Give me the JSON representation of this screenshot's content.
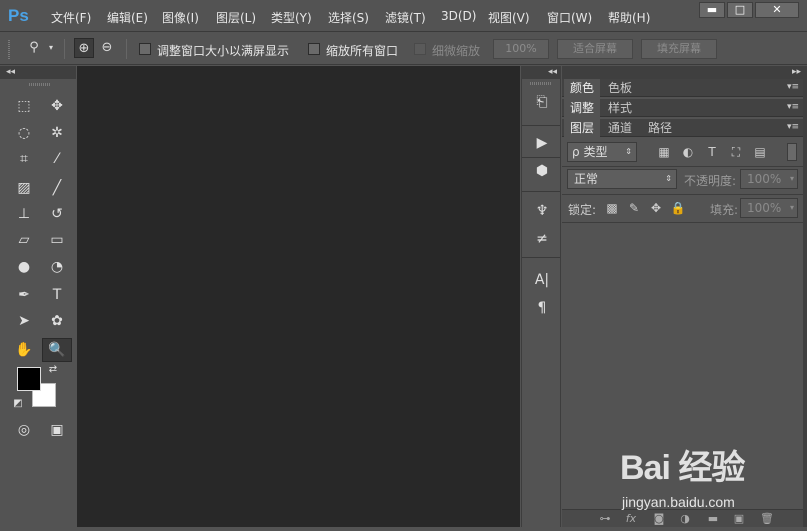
{
  "app": {
    "logo": "Ps"
  },
  "menu": [
    "文件(F)",
    "编辑(E)",
    "图像(I)",
    "图层(L)",
    "类型(Y)",
    "选择(S)",
    "滤镜(T)",
    "3D(D)",
    "视图(V)",
    "窗口(W)",
    "帮助(H)"
  ],
  "window_controls": {
    "minimize": "▬",
    "maximize": "□",
    "close": "✕"
  },
  "options_bar": {
    "resize_windows_label": "调整窗口大小以满屏显示",
    "resize_windows_checked": false,
    "zoom_all_label": "缩放所有窗口",
    "zoom_all_checked": false,
    "scrubby_zoom_label": "细微缩放",
    "scrubby_zoom_checked": false,
    "zoom_value": "100%",
    "fit_screen_label": "适合屏幕",
    "fill_screen_label": "填充屏幕"
  },
  "collapse_glyph": "◂◂",
  "expand_glyph": "▸▸",
  "tools": [
    {
      "name": "rectangular-marquee",
      "icon": "⬚"
    },
    {
      "name": "move",
      "icon": "✥"
    },
    {
      "name": "lasso",
      "icon": "◌"
    },
    {
      "name": "magic-wand",
      "icon": "✲"
    },
    {
      "name": "crop",
      "icon": "⌗"
    },
    {
      "name": "eyedropper",
      "icon": "⁄"
    },
    {
      "name": "healing-brush",
      "icon": "▨"
    },
    {
      "name": "brush",
      "icon": "╱"
    },
    {
      "name": "clone-stamp",
      "icon": "⊥"
    },
    {
      "name": "history-brush",
      "icon": "↺"
    },
    {
      "name": "eraser",
      "icon": "▱"
    },
    {
      "name": "gradient",
      "icon": "▭"
    },
    {
      "name": "blur",
      "icon": "●"
    },
    {
      "name": "dodge",
      "icon": "◔"
    },
    {
      "name": "pen",
      "icon": "✒"
    },
    {
      "name": "type",
      "icon": "T"
    },
    {
      "name": "path-selection",
      "icon": "➤"
    },
    {
      "name": "custom-shape",
      "icon": "✿"
    },
    {
      "name": "hand",
      "icon": "✋"
    },
    {
      "name": "zoom",
      "icon": "🔍"
    }
  ],
  "colors": {
    "foreground": "#000000",
    "background": "#ffffff",
    "canvas": "#282828",
    "ui": "#535353",
    "brand": "#4ba3e6"
  },
  "swap_glyph": "⇄",
  "default_colors_glyph": "◩",
  "quick_mask_glyph": "◎",
  "screen_mode_glyph": "▣",
  "dock_icons": [
    {
      "name": "history",
      "icon": "⎗"
    },
    {
      "name": "actions",
      "icon": "▶"
    },
    {
      "name": "3d",
      "icon": "⬢"
    },
    {
      "name": "brush-presets",
      "icon": "♆"
    },
    {
      "name": "brush-settings",
      "icon": "≠"
    },
    {
      "name": "character",
      "icon": "A|"
    },
    {
      "name": "paragraph",
      "icon": "¶"
    }
  ],
  "panels": {
    "color_group": [
      "颜色",
      "色板"
    ],
    "adjust_group": [
      "调整",
      "样式"
    ],
    "layers_group": [
      "图层",
      "通道",
      "路径"
    ],
    "menu_glyph": "▾≡"
  },
  "layers": {
    "filter_label": "类型",
    "filter_glyph": "ρ",
    "blend_mode": "正常",
    "opacity_label": "不透明度:",
    "opacity_value": "100%",
    "lock_label": "锁定:",
    "fill_label": "填充:",
    "fill_value": "100%",
    "filter_icons": [
      "▦",
      "◐",
      "T",
      "⛶",
      "▤"
    ],
    "lock_icons": [
      "▩",
      "✎",
      "✥",
      "🔒"
    ],
    "footer_icons": [
      "⊶",
      "fx",
      "◙",
      "◑",
      "▬",
      "▣",
      "🗑"
    ]
  },
  "watermark": {
    "logo": "Bai 经验",
    "url": "jingyan.baidu.com"
  }
}
